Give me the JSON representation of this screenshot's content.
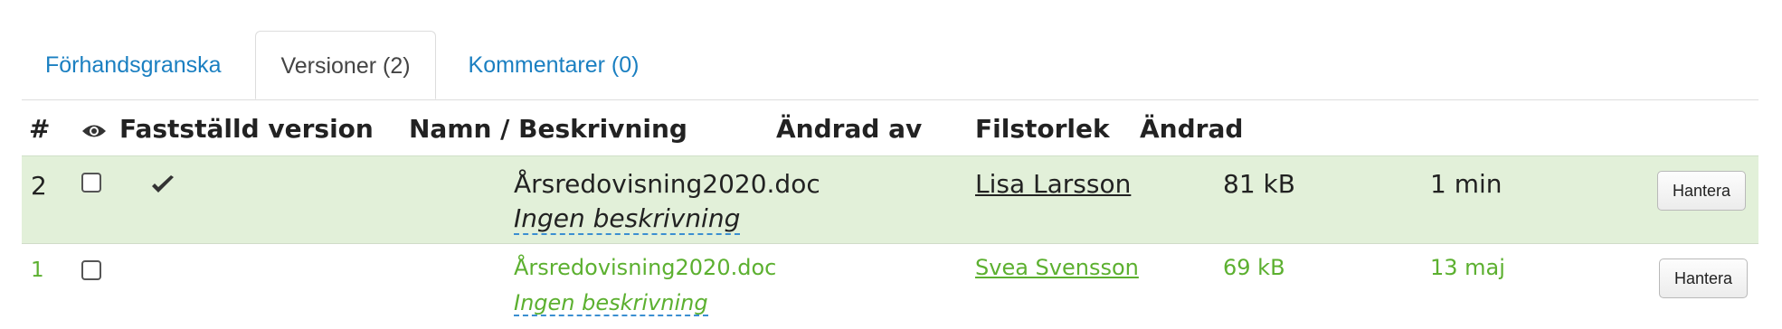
{
  "tabs": [
    {
      "label": "Förhandsgranska",
      "active": false
    },
    {
      "label": "Versioner (2)",
      "active": true
    },
    {
      "label": "Kommentarer (0)",
      "active": false
    }
  ],
  "table": {
    "headers": {
      "num": "#",
      "view_icon": "eye-icon",
      "fixed_version": "Fastställd version",
      "name": "Namn / Beskrivning",
      "changed_by": "Ändrad av",
      "filesize": "Filstorlek",
      "changed": "Ändrad"
    },
    "rows": [
      {
        "num": "2",
        "checked": false,
        "fixed": true,
        "filename": "Årsredovisning2020.doc",
        "description": "Ingen beskrivning",
        "author": "Lisa Larsson",
        "size": "81 kB",
        "changed": "1 min",
        "action": "Hantera"
      },
      {
        "num": "1",
        "checked": false,
        "fixed": false,
        "filename": "Årsredovisning2020.doc",
        "description": "Ingen beskrivning",
        "author": "Svea Svensson",
        "size": "69 kB",
        "changed": "13 maj",
        "action": "Hantera"
      }
    ]
  },
  "colors": {
    "link": "#1a7fc1",
    "current_row_bg": "#e2f0d9",
    "older_row_text": "#5cb030"
  }
}
